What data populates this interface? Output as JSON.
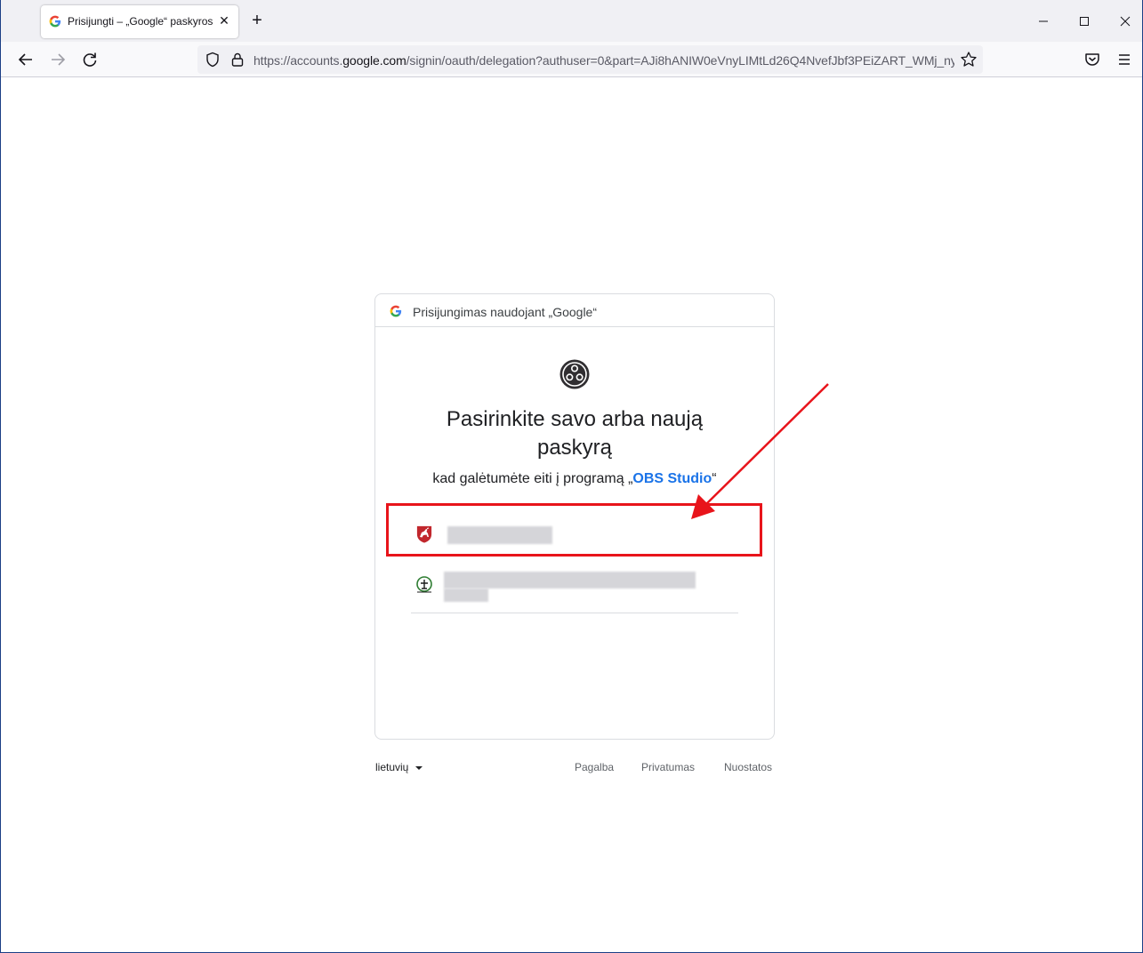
{
  "browser": {
    "tab_title": "Prisijungti – „Google“ paskyros",
    "url_prefix": "https://accounts.",
    "url_domain": "google.com",
    "url_suffix": "/signin/oauth/delegation?authuser=0&part=AJi8hANIW0eVnyLIMtLd26Q4NvefJbf3PEiZART_WMj_ny",
    "new_tab_label": "+",
    "close_glyph": "✕",
    "minimize_glyph": "—",
    "maximize_glyph": "☐",
    "window_close_glyph": "✕"
  },
  "card": {
    "header_text": "Prisijungimas naudojant „Google“",
    "heading": "Pasirinkite savo arba naują paskyrą",
    "subheading_prefix": "kad galėtumėte eiti į programą „",
    "app_name": "OBS Studio",
    "subheading_suffix": "“"
  },
  "footer": {
    "language": "lietuvių",
    "help": "Pagalba",
    "privacy": "Privatumas",
    "terms": "Nuostatos"
  },
  "colors": {
    "annotation": "#e8141b",
    "link": "#1a73e8"
  }
}
